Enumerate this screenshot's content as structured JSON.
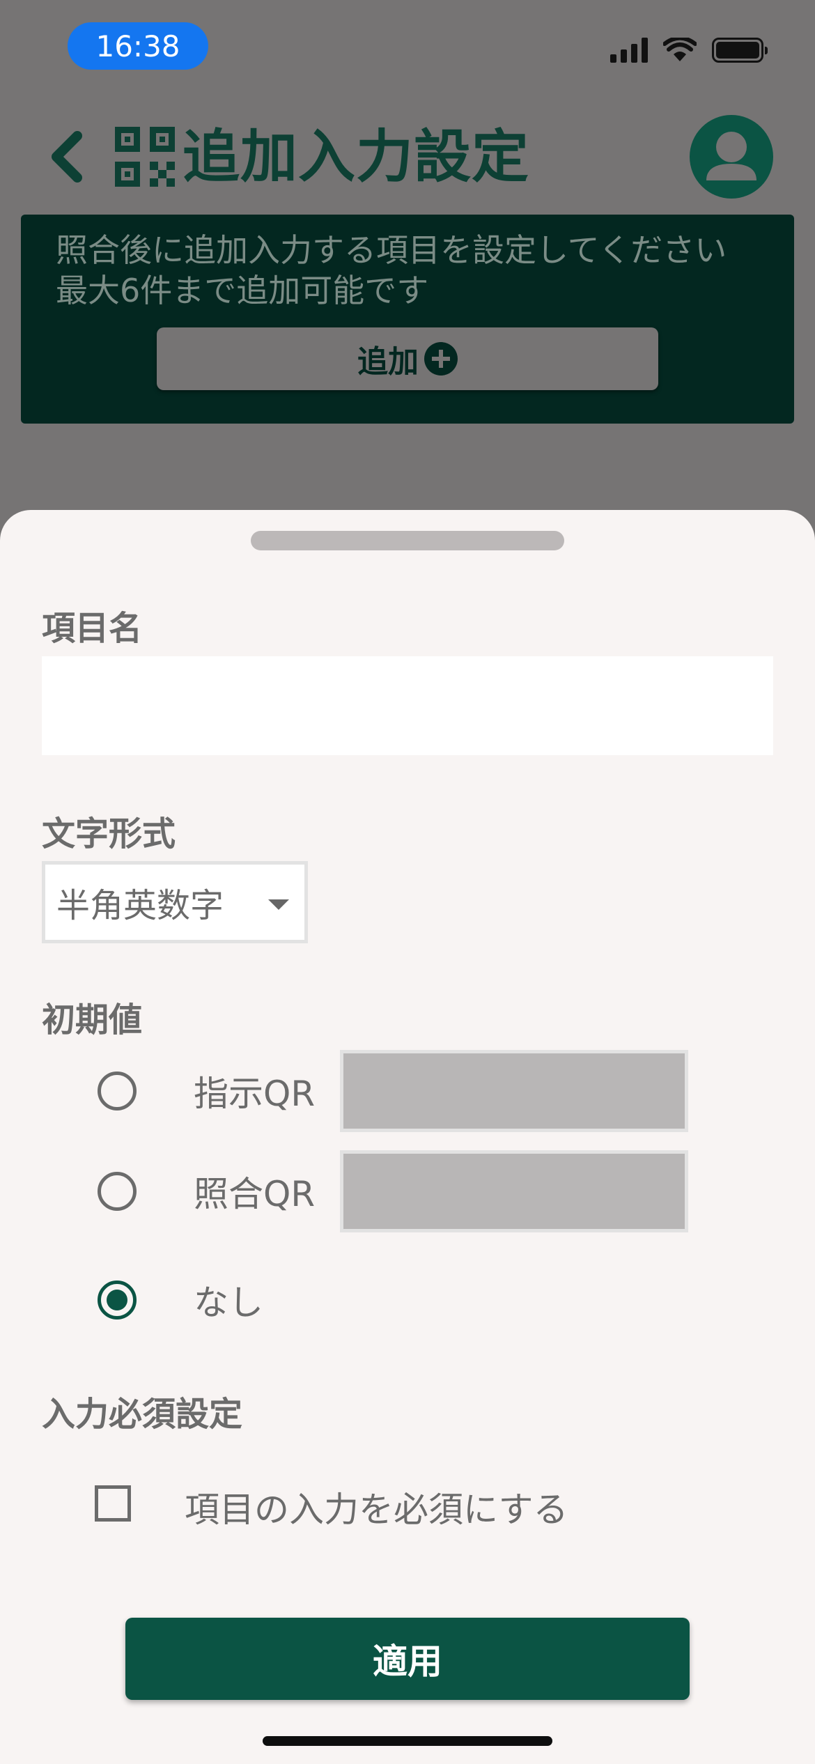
{
  "status_bar": {
    "time": "16:38"
  },
  "header": {
    "title": "追加入力設定"
  },
  "banner": {
    "line1": "照合後に追加入力する項目を設定してください",
    "line2": "最大6件まで追加可能です",
    "add_label": "追加"
  },
  "sheet": {
    "item_name_label": "項目名",
    "item_name_value": "",
    "format_label": "文字形式",
    "format_value": "半角英数字",
    "initial_label": "初期値",
    "options": [
      {
        "label": "指示QR",
        "selected": false
      },
      {
        "label": "照合QR",
        "selected": false
      },
      {
        "label": "なし",
        "selected": true
      }
    ],
    "required_label": "入力必須設定",
    "required_checkbox_label": "項目の入力を必須にする",
    "required_checked": false,
    "apply_label": "適用"
  },
  "colors": {
    "accent": "#0b5444",
    "banner": "#032720",
    "overlay": "#767474",
    "sheet": "#f8f4f3"
  }
}
